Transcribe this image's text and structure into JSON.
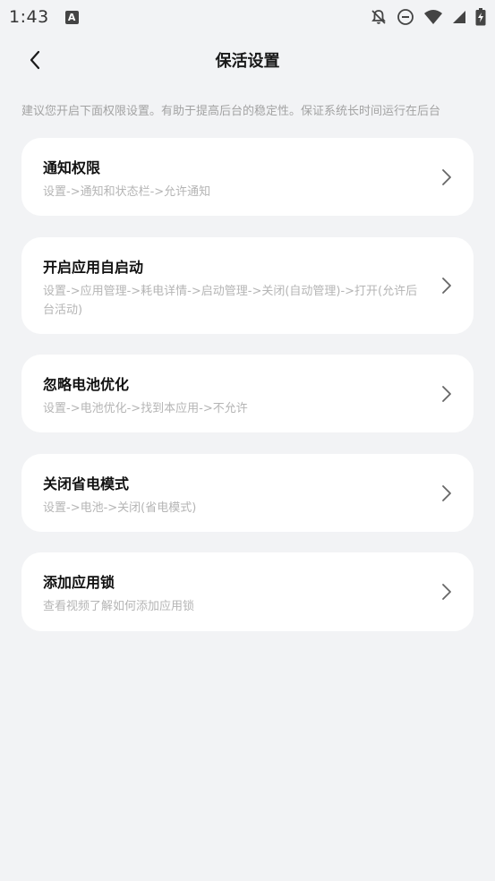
{
  "status_bar": {
    "time": "1:43",
    "notification_icon_letter": "A"
  },
  "nav": {
    "title": "保活设置"
  },
  "hint": "建议您开启下面权限设置。有助于提高后台的稳定性。保证系统长时间运行在后台",
  "cards": [
    {
      "title": "通知权限",
      "desc": "设置->通知和状态栏->允许通知"
    },
    {
      "title": "开启应用自启动",
      "desc": "设置->应用管理->耗电详情->启动管理->关闭(自动管理)->打开(允许后台活动)"
    },
    {
      "title": "忽略电池优化",
      "desc": "设置->电池优化->找到本应用->不允许"
    },
    {
      "title": "关闭省电模式",
      "desc": "设置->电池->关闭(省电模式)"
    },
    {
      "title": "添加应用锁",
      "desc": "查看视频了解如何添加应用锁"
    }
  ]
}
